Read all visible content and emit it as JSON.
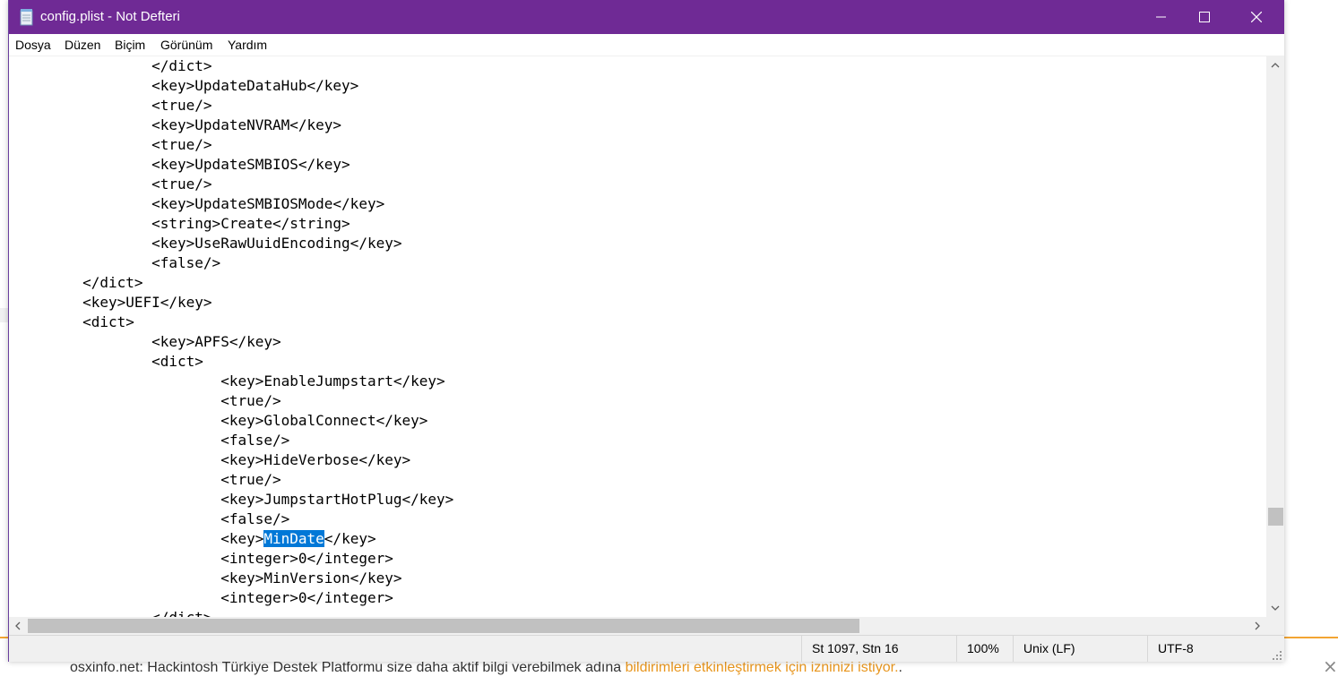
{
  "window": {
    "title": "config.plist - Not Defteri",
    "buttons": {
      "minimize": "minimize-icon",
      "maximize": "maximize-icon",
      "close": "close-icon"
    }
  },
  "menu": [
    {
      "label": "Dosya"
    },
    {
      "label": "Düzen"
    },
    {
      "label": "Biçim"
    },
    {
      "label": "Görünüm"
    },
    {
      "label": "Yardım"
    }
  ],
  "editor": {
    "lines": [
      "                </dict>",
      "                <key>UpdateDataHub</key>",
      "                <true/>",
      "                <key>UpdateNVRAM</key>",
      "                <true/>",
      "                <key>UpdateSMBIOS</key>",
      "                <true/>",
      "                <key>UpdateSMBIOSMode</key>",
      "                <string>Create</string>",
      "                <key>UseRawUuidEncoding</key>",
      "                <false/>",
      "        </dict>",
      "        <key>UEFI</key>",
      "        <dict>",
      "                <key>APFS</key>",
      "                <dict>",
      "                        <key>EnableJumpstart</key>",
      "                        <true/>",
      "                        <key>GlobalConnect</key>",
      "                        <false/>",
      "                        <key>HideVerbose</key>",
      "                        <true/>",
      "                        <key>JumpstartHotPlug</key>",
      "                        <false/>",
      "                        <key>MinDate</key>",
      "                        <integer>0</integer>",
      "                        <key>MinVersion</key>",
      "                        <integer>0</integer>",
      "                </dict>"
    ],
    "selected_line_index": 24,
    "selection": {
      "before": "                        <key>",
      "selected": "MinDate",
      "after": "</key>"
    }
  },
  "status": {
    "position": "St 1097, Stn 16",
    "zoom": "100%",
    "line_ending": "Unix (LF)",
    "encoding": "UTF-8"
  },
  "background_notice": {
    "text": "osxinfo.net: Hackintosh Türkiye Destek Platformu size daha aktif bilgi verebilmek adına ",
    "link": "bildirimleri etkinleştirmek için izninizi istiyor.",
    "suffix": ".",
    "close": "×"
  },
  "colors": {
    "titlebar": "#6f2a95",
    "selection": "#0078d7",
    "notice_link": "#e8961e"
  }
}
